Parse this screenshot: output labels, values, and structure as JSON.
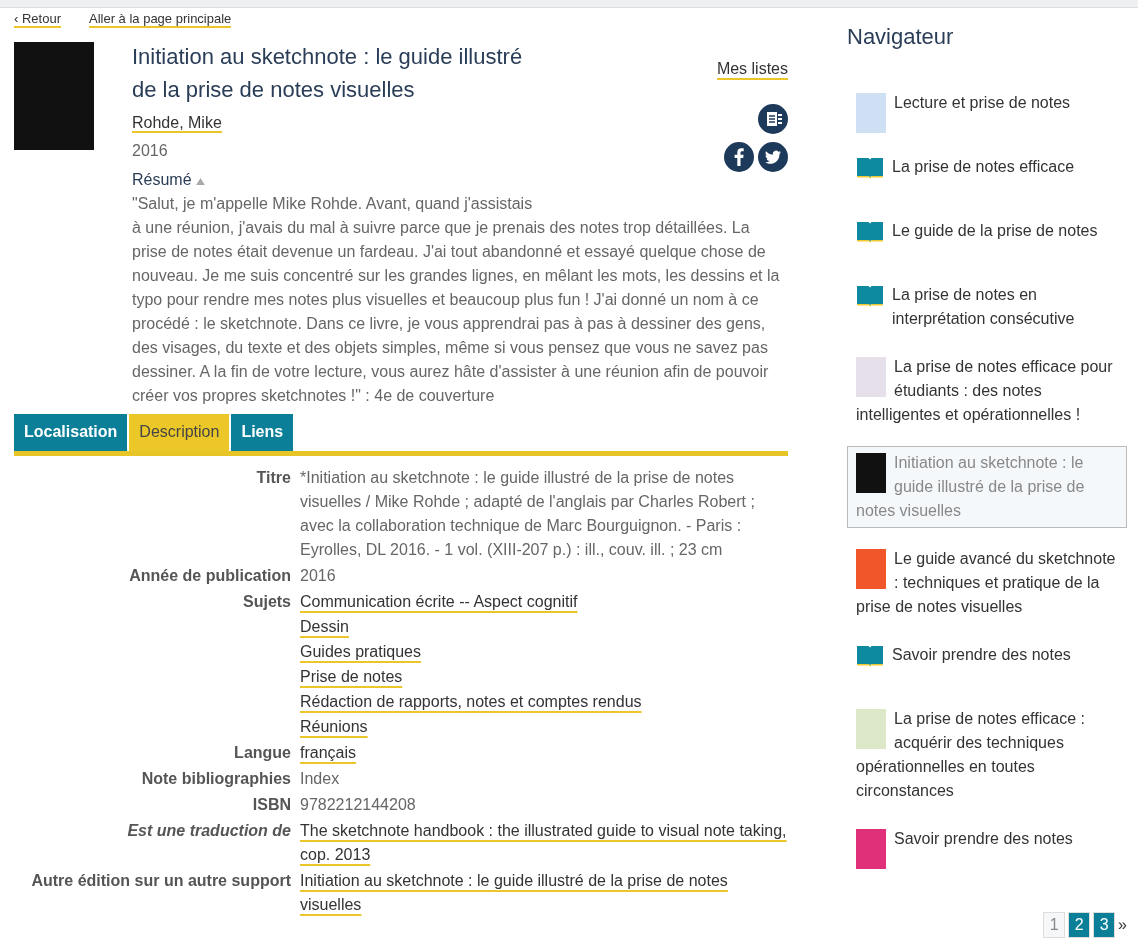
{
  "top_links": [
    "‹ Retour",
    "Aller à la page principale"
  ],
  "book": {
    "title": "Initiation au sketchnote : le guide illustré de la prise de notes visuelles",
    "author": "Rohde, Mike",
    "year": "2016",
    "my_lists": "Mes listes",
    "summary_label": "Résumé",
    "summary_expanded": true,
    "summary": "\"Salut, je m'appelle Mike Rohde. Avant, quand j'assistais à une réunion, j'avais du mal à suivre parce que je prenais des notes trop détaillées. La prise de notes était devenue un fardeau. J'ai tout abandonné et essayé quelque chose de nouveau. Je me suis concentré sur les grandes lignes, en mêlant les mots, les dessins et la typo pour rendre mes notes plus visuelles et beaucoup plus fun ! J'ai donné un nom à ce procédé : le sketchnote. Dans ce livre, je vous apprendrai pas à pas à dessiner des gens, des visages, du texte et des objets simples, même si vous pensez que vous ne savez pas dessiner. A la fin de votre lecture, vous aurez hâte d'assister à une réunion afin de pouvoir créer vos propres sketchnotes !\" : 4e de couverture"
  },
  "tabs": [
    {
      "label": "Localisation",
      "selected": false
    },
    {
      "label": "Description",
      "selected": true
    },
    {
      "label": "Liens",
      "selected": false
    }
  ],
  "details": [
    {
      "label": "Titre",
      "italic": false,
      "kind": "text",
      "value": "*Initiation au sketchnote : le guide illustré de la prise de notes visuelles / Mike Rohde ; adapté de l'anglais par Charles Robert ; avec la collaboration technique de Marc Bourguignon. - Paris : Eyrolles, DL 2016. - 1 vol. (XIII-207 p.) : ill., couv. ill. ; 23 cm"
    },
    {
      "label": "Année de publication",
      "italic": false,
      "kind": "text",
      "value": "2016"
    },
    {
      "label": "Sujets",
      "italic": false,
      "kind": "links",
      "links": [
        "Communication écrite -- Aspect cognitif",
        "Dessin",
        "Guides pratiques",
        "Prise de notes",
        "Rédaction de rapports, notes et comptes rendus",
        "Réunions"
      ]
    },
    {
      "label": "Langue",
      "italic": false,
      "kind": "links",
      "links": [
        "français"
      ]
    },
    {
      "label": "Note bibliographies",
      "italic": false,
      "kind": "text",
      "value": "Index"
    },
    {
      "label": "ISBN",
      "italic": false,
      "kind": "text",
      "value": "9782212144208"
    },
    {
      "label": "Est une traduction de",
      "italic": true,
      "kind": "links",
      "links": [
        "The sketchnote handbook : the illustrated guide to visual note taking, cop. 2013"
      ]
    },
    {
      "label": "Autre édition sur un autre support",
      "italic": false,
      "kind": "links",
      "links": [
        "Initiation au sketchnote : le guide illustré de la prise de notes visuelles"
      ]
    }
  ],
  "navigator": {
    "title": "Navigateur",
    "items": [
      {
        "title": "Lecture et prise de notes",
        "kind": "cover",
        "color": "#cfe0f5",
        "selected": false
      },
      {
        "title": "La prise de notes efficace",
        "kind": "book",
        "selected": false
      },
      {
        "title": "Le guide de la prise de notes",
        "kind": "book",
        "selected": false
      },
      {
        "title": "La prise de notes en interprétation consécutive",
        "kind": "book",
        "selected": false
      },
      {
        "title": "La prise de notes efficace pour étudiants : des notes intelligentes et opérationnelles !",
        "kind": "cover",
        "color": "#e6e0ea",
        "selected": false
      },
      {
        "title": "Initiation au sketchnote : le guide illustré de la prise de notes visuelles",
        "kind": "cover",
        "color": "#111111",
        "selected": true
      },
      {
        "title": "Le guide avancé du sketchnote : techniques et pratique de la prise de notes visuelles",
        "kind": "cover",
        "color": "#f0562a",
        "selected": false
      },
      {
        "title": "Savoir prendre des notes",
        "kind": "book",
        "selected": false
      },
      {
        "title": "La prise de notes efficace : acquérir des techniques opérationnelles en toutes circonstances",
        "kind": "cover",
        "color": "#dde8c8",
        "selected": false
      },
      {
        "title": "Savoir prendre des notes",
        "kind": "cover",
        "color": "#e0307a",
        "selected": false
      }
    ],
    "pages": [
      {
        "label": "1",
        "selected": true
      },
      {
        "label": "2",
        "selected": false
      },
      {
        "label": "3",
        "selected": false
      }
    ],
    "next": "»"
  }
}
